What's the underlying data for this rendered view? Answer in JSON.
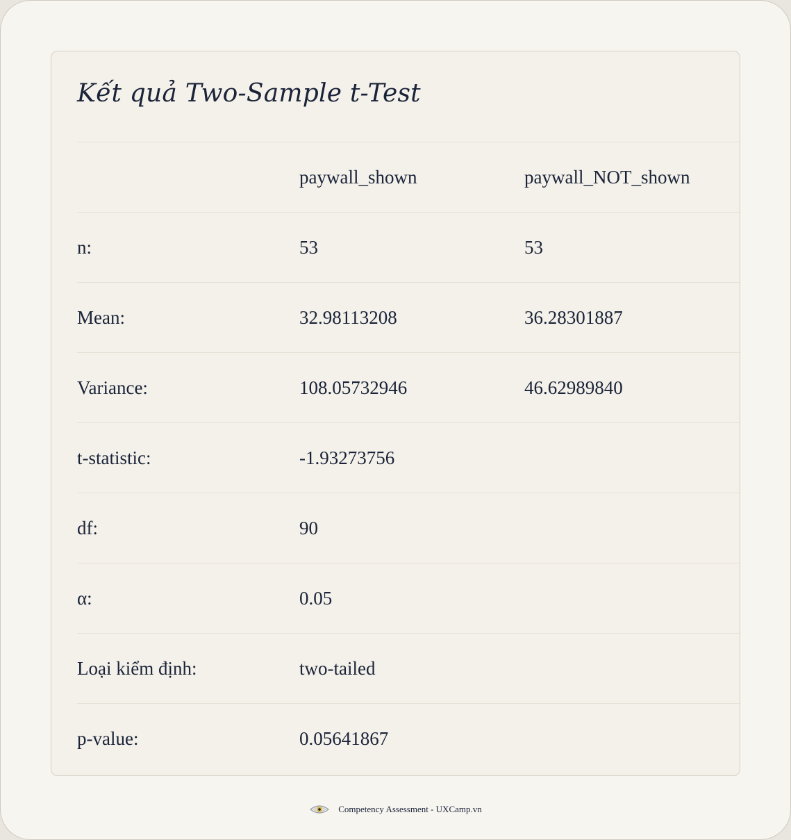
{
  "card": {
    "title": "Kết quả Two-Sample t-Test"
  },
  "table": {
    "headers": [
      "",
      "paywall_shown",
      "paywall_NOT_shown"
    ],
    "rows": [
      {
        "label": "n:",
        "shown": "53",
        "not_shown": "53"
      },
      {
        "label": "Mean:",
        "shown": "32.98113208",
        "not_shown": "36.28301887"
      },
      {
        "label": "Variance:",
        "shown": "108.05732946",
        "not_shown": "46.62989840"
      },
      {
        "label": "t-statistic:",
        "shown": "-1.93273756",
        "not_shown": ""
      },
      {
        "label": "df:",
        "shown": "90",
        "not_shown": ""
      },
      {
        "label": "α:",
        "shown": "0.05",
        "not_shown": ""
      },
      {
        "label": "Loại kiểm định:",
        "shown": "two-tailed",
        "not_shown": ""
      },
      {
        "label": "p-value:",
        "shown": "0.05641867",
        "not_shown": ""
      }
    ]
  },
  "footer": {
    "icon": "eye-icon",
    "text": "Competency Assessment - UXCamp.vn"
  },
  "colors": {
    "text": "#1a2338",
    "background": "#f7f5f0",
    "card": "#f4f1ea",
    "border": "#d6d0c4"
  }
}
